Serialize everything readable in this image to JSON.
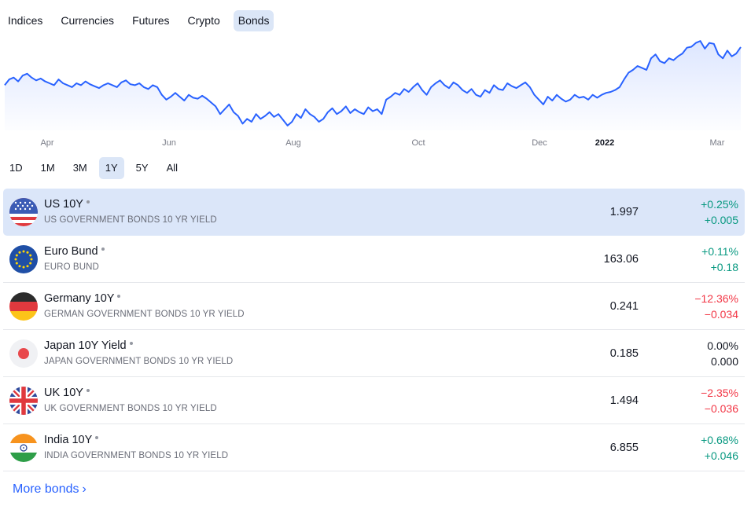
{
  "tabs": [
    {
      "label": "Indices"
    },
    {
      "label": "Currencies"
    },
    {
      "label": "Futures"
    },
    {
      "label": "Crypto"
    },
    {
      "label": "Bonds",
      "active": true
    }
  ],
  "chart_data": {
    "type": "area",
    "x_tick_labels": [
      "Apr",
      "Jun",
      "Aug",
      "Oct",
      "Dec",
      "2022",
      "Mar"
    ],
    "line_color": "#2962ff",
    "grid": false,
    "y": [
      1.6,
      1.66,
      1.68,
      1.64,
      1.7,
      1.72,
      1.68,
      1.65,
      1.67,
      1.64,
      1.62,
      1.6,
      1.66,
      1.62,
      1.6,
      1.58,
      1.62,
      1.6,
      1.64,
      1.61,
      1.59,
      1.57,
      1.6,
      1.62,
      1.6,
      1.58,
      1.63,
      1.65,
      1.61,
      1.6,
      1.62,
      1.58,
      1.56,
      1.6,
      1.58,
      1.5,
      1.45,
      1.48,
      1.52,
      1.48,
      1.44,
      1.5,
      1.47,
      1.46,
      1.49,
      1.46,
      1.42,
      1.38,
      1.3,
      1.35,
      1.4,
      1.32,
      1.28,
      1.2,
      1.25,
      1.22,
      1.3,
      1.25,
      1.28,
      1.32,
      1.27,
      1.3,
      1.24,
      1.18,
      1.22,
      1.3,
      1.26,
      1.35,
      1.3,
      1.27,
      1.22,
      1.25,
      1.32,
      1.36,
      1.3,
      1.33,
      1.38,
      1.31,
      1.35,
      1.32,
      1.3,
      1.37,
      1.33,
      1.35,
      1.3,
      1.45,
      1.48,
      1.52,
      1.5,
      1.56,
      1.53,
      1.58,
      1.62,
      1.55,
      1.5,
      1.58,
      1.62,
      1.65,
      1.6,
      1.57,
      1.63,
      1.6,
      1.55,
      1.52,
      1.56,
      1.5,
      1.48,
      1.55,
      1.52,
      1.6,
      1.56,
      1.55,
      1.62,
      1.59,
      1.57,
      1.6,
      1.63,
      1.58,
      1.5,
      1.45,
      1.4,
      1.48,
      1.44,
      1.5,
      1.46,
      1.43,
      1.45,
      1.5,
      1.47,
      1.48,
      1.45,
      1.5,
      1.47,
      1.5,
      1.52,
      1.53,
      1.55,
      1.58,
      1.66,
      1.73,
      1.76,
      1.8,
      1.78,
      1.76,
      1.88,
      1.92,
      1.85,
      1.83,
      1.88,
      1.86,
      1.9,
      1.93,
      1.99,
      2.0,
      2.04,
      2.06,
      1.98,
      2.04,
      2.03,
      1.92,
      1.88,
      1.96,
      1.9,
      1.93,
      1.997
    ]
  },
  "ranges": [
    {
      "label": "1D"
    },
    {
      "label": "1M"
    },
    {
      "label": "3M"
    },
    {
      "label": "1Y",
      "active": true
    },
    {
      "label": "5Y"
    },
    {
      "label": "All"
    }
  ],
  "rows": [
    {
      "key": "us",
      "name": "US 10Y",
      "desc": "US GOVERNMENT BONDS 10 YR YIELD",
      "value": "1.997",
      "pct": "+0.25%",
      "abs": "+0.005",
      "dir": "up",
      "selected": true
    },
    {
      "key": "eu",
      "name": "Euro Bund",
      "desc": "EURO BUND",
      "value": "163.06",
      "pct": "+0.11%",
      "abs": "+0.18",
      "dir": "up"
    },
    {
      "key": "de",
      "name": "Germany 10Y",
      "desc": "GERMAN GOVERNMENT BONDS 10 YR YIELD",
      "value": "0.241",
      "pct": "−12.36%",
      "abs": "−0.034",
      "dir": "down"
    },
    {
      "key": "jp",
      "name": "Japan 10Y Yield",
      "desc": "JAPAN GOVERNMENT BONDS 10 YR YIELD",
      "value": "0.185",
      "pct": "0.00%",
      "abs": "0.000",
      "dir": "flat"
    },
    {
      "key": "uk",
      "name": "UK 10Y",
      "desc": "UK GOVERNMENT BONDS 10 YR YIELD",
      "value": "1.494",
      "pct": "−2.35%",
      "abs": "−0.036",
      "dir": "down"
    },
    {
      "key": "in",
      "name": "India 10Y",
      "desc": "INDIA GOVERNMENT BONDS 10 YR YIELD",
      "value": "6.855",
      "pct": "+0.68%",
      "abs": "+0.046",
      "dir": "up"
    }
  ],
  "more_link": {
    "label": "More bonds",
    "chevron": "›"
  },
  "colors": {
    "up": "#089981",
    "down": "#f23645",
    "accent": "#2962ff",
    "selected_bg": "#dbe6f9"
  }
}
